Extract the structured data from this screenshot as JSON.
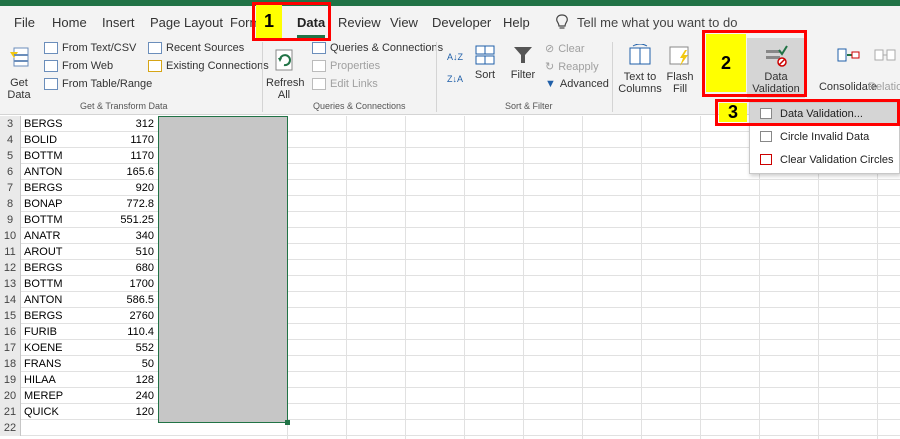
{
  "tabs": [
    "File",
    "Home",
    "Insert",
    "Page Layout",
    "Form",
    "Data",
    "Review",
    "View",
    "Developer",
    "Help"
  ],
  "tell_me": "Tell me what you want to do",
  "ribbon": {
    "get_data": "Get Data",
    "from_text_csv": "From Text/CSV",
    "from_web": "From Web",
    "from_table_range": "From Table/Range",
    "recent_sources": "Recent Sources",
    "existing_connections": "Existing Connections",
    "group_get_transform": "Get & Transform Data",
    "refresh_all": "Refresh All",
    "queries_connections": "Queries & Connections",
    "properties": "Properties",
    "edit_links": "Edit Links",
    "group_queries": "Queries & Connections",
    "sort": "Sort",
    "filter": "Filter",
    "clear": "Clear",
    "reapply": "Reapply",
    "advanced": "Advanced",
    "group_sort_filter": "Sort & Filter",
    "text_to_columns": "Text to Columns",
    "flash_fill": "Flash Fill",
    "data_validation": "Data Validation",
    "consolidate": "Consolidate",
    "relationships": "Relation"
  },
  "dropdown": [
    "Data Validation...",
    "Circle Invalid Data",
    "Clear Validation Circles"
  ],
  "callouts": [
    "1",
    "2",
    "3"
  ],
  "rows": [
    {
      "n": "3",
      "a": "BERGS",
      "b": "312"
    },
    {
      "n": "4",
      "a": "BOLID",
      "b": "1170"
    },
    {
      "n": "5",
      "a": "BOTTM",
      "b": "1170"
    },
    {
      "n": "6",
      "a": "ANTON",
      "b": "165.6"
    },
    {
      "n": "7",
      "a": "BERGS",
      "b": "920"
    },
    {
      "n": "8",
      "a": "BONAP",
      "b": "772.8"
    },
    {
      "n": "9",
      "a": "BOTTM",
      "b": "551.25"
    },
    {
      "n": "10",
      "a": "ANATR",
      "b": "340"
    },
    {
      "n": "11",
      "a": "AROUT",
      "b": "510"
    },
    {
      "n": "12",
      "a": "BERGS",
      "b": "680"
    },
    {
      "n": "13",
      "a": "BOTTM",
      "b": "1700"
    },
    {
      "n": "14",
      "a": "ANTON",
      "b": "586.5"
    },
    {
      "n": "15",
      "a": "BERGS",
      "b": "2760"
    },
    {
      "n": "16",
      "a": "FURIB",
      "b": "110.4"
    },
    {
      "n": "17",
      "a": "KOENE",
      "b": "552"
    },
    {
      "n": "18",
      "a": "FRANS",
      "b": "50"
    },
    {
      "n": "19",
      "a": "HILAA",
      "b": "128"
    },
    {
      "n": "20",
      "a": "MEREP",
      "b": "240"
    },
    {
      "n": "21",
      "a": "QUICK",
      "b": "120"
    },
    {
      "n": "22",
      "a": "",
      "b": ""
    }
  ],
  "colors": {
    "accent": "#217346",
    "callout_border": "#ff0000",
    "callout_fill": "#ffff00",
    "selection": "#c6c6c6"
  }
}
